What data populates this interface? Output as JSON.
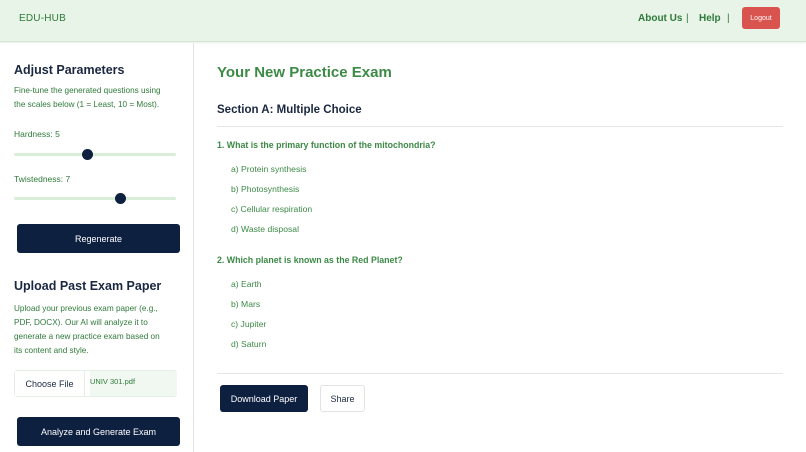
{
  "header": {
    "brand": "EDU-HUB",
    "nav": [
      "About Us",
      "Help"
    ],
    "separator": "|",
    "logout_label": "Logout"
  },
  "sidebar": {
    "params_title": "Adjust Parameters",
    "params_desc_line1": "Fine-tune the generated questions using",
    "params_desc_line2": "the scales below (1 = Least, 10 = Most).",
    "sliders": [
      {
        "label": "Hardness: 5",
        "value": 5,
        "min": 1,
        "max": 10
      },
      {
        "label": "Twistedness: 7",
        "value": 7,
        "min": 1,
        "max": 10
      }
    ],
    "regenerate_label": "Regenerate",
    "upload_title": "Upload Past Exam Paper",
    "upload_desc": [
      "Upload your previous exam paper (e.g.,",
      "PDF, DOCX). Our AI will analyze it to",
      "generate a new practice exam based on",
      "its content and style."
    ],
    "choose_file_label": "Choose File",
    "file_name": "UNIV 301.pdf",
    "analyze_label": "Analyze and Generate Exam"
  },
  "main": {
    "title": "Your New Practice Exam",
    "section_title": "Section A: Multiple Choice",
    "questions": [
      {
        "text": "1. What is the primary function of the mitochondria?",
        "options": [
          "a) Protein synthesis",
          "b) Photosynthesis",
          "c) Cellular respiration",
          "d) Waste disposal"
        ]
      },
      {
        "text": "2. Which planet is known as the Red Planet?",
        "options": [
          "a) Earth",
          "b) Mars",
          "c) Jupiter",
          "d) Saturn"
        ]
      }
    ],
    "download_label": "Download Paper",
    "share_label": "Share"
  }
}
